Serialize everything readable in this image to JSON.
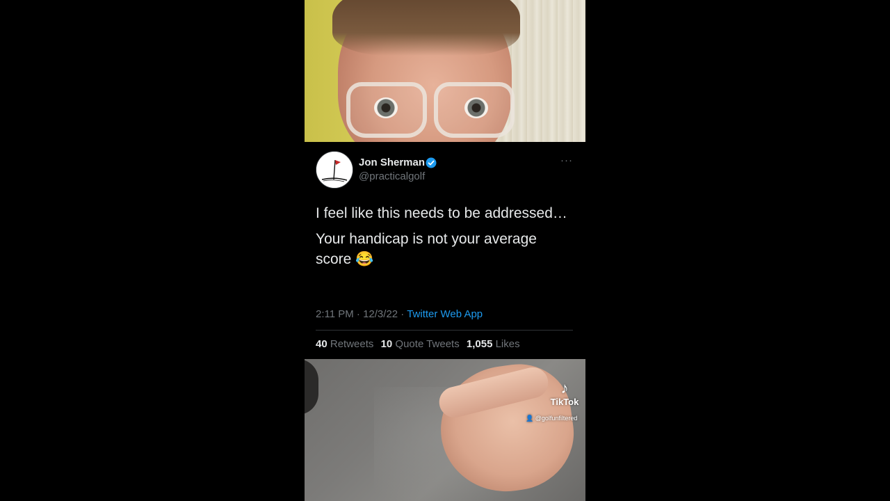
{
  "tweet": {
    "display_name": "Jon Sherman",
    "handle": "@practicalgolf",
    "more_label": "···",
    "paragraphs": [
      "I feel like this needs to be addressed…",
      "Your handicap is not your average score 😂"
    ],
    "time": "2:11 PM · 12/3/22 · ",
    "source_app": "Twitter Web App",
    "stats": {
      "retweets_count": "40",
      "retweets_label": "Retweets",
      "quotes_count": "10",
      "quotes_label": "Quote Tweets",
      "likes_count": "1,055",
      "likes_label": "Likes"
    }
  },
  "watermark": {
    "brand": "TikTok",
    "username": "@golfunfiltered",
    "logo_icon": "tiktok-note-icon"
  },
  "colors": {
    "background": "#000000",
    "accent": "#1d9bf0",
    "text_primary": "#e7e9ea",
    "text_secondary": "#71767b"
  }
}
